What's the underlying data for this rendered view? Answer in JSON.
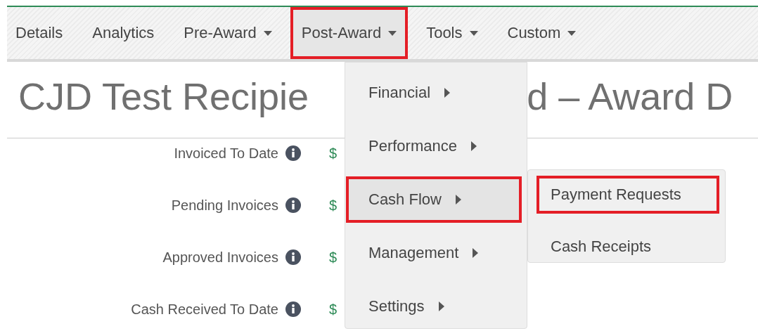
{
  "tabs": [
    {
      "label": "Details",
      "dropdown": false,
      "highlighted": false
    },
    {
      "label": "Analytics",
      "dropdown": false,
      "highlighted": false
    },
    {
      "label": "Pre-Award",
      "dropdown": true,
      "highlighted": false
    },
    {
      "label": "Post-Award",
      "dropdown": true,
      "highlighted": true
    },
    {
      "label": "Tools",
      "dropdown": true,
      "highlighted": false
    },
    {
      "label": "Custom",
      "dropdown": true,
      "highlighted": false
    }
  ],
  "title_parts": [
    "CJD Test Recipie",
    "d – Award D"
  ],
  "summary": [
    {
      "label": "Invoiced To Date",
      "value": "$"
    },
    {
      "label": "Pending Invoices",
      "value": "$"
    },
    {
      "label": "Approved Invoices",
      "value": "$"
    },
    {
      "label": "Cash Received To Date",
      "value": "$"
    }
  ],
  "menu": {
    "items": [
      {
        "label": "Financial",
        "highlighted": false
      },
      {
        "label": "Performance",
        "highlighted": false
      },
      {
        "label": "Cash Flow",
        "highlighted": true
      },
      {
        "label": "Management",
        "highlighted": false
      },
      {
        "label": "Settings",
        "highlighted": false
      }
    ]
  },
  "submenu": {
    "items": [
      {
        "label": "Payment Requests",
        "highlighted": true
      },
      {
        "label": "Cash Receipts",
        "highlighted": false
      }
    ]
  }
}
